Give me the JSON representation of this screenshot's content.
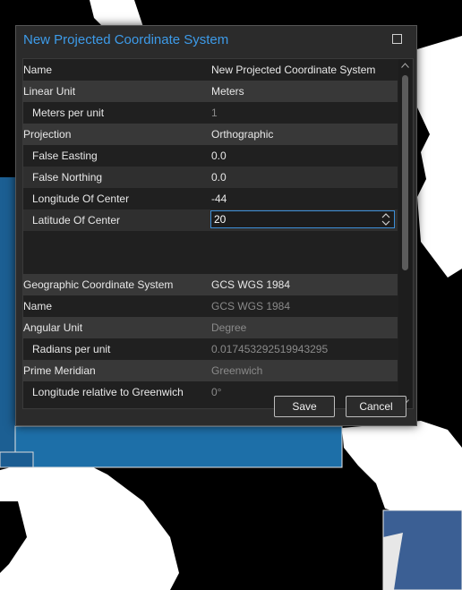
{
  "dialog": {
    "title": "New Projected Coordinate System",
    "maximize_icon": "maximize-icon",
    "rows": [
      {
        "name": "Name",
        "value": "New Projected Coordinate System"
      },
      {
        "name": "Linear Unit",
        "value": "Meters"
      },
      {
        "name": "Meters per unit",
        "value": "1"
      },
      {
        "name": "Projection",
        "value": "Orthographic"
      },
      {
        "name": "False Easting",
        "value": "0.0"
      },
      {
        "name": "False Northing",
        "value": "0.0"
      },
      {
        "name": "Longitude Of Center",
        "value": "-44"
      },
      {
        "name": "Latitude Of Center",
        "value": "20"
      },
      {
        "name": "",
        "value": ""
      },
      {
        "name": "Geographic Coordinate System",
        "value": "GCS WGS 1984"
      },
      {
        "name": "Name",
        "value": "GCS WGS 1984"
      },
      {
        "name": "Angular Unit",
        "value": "Degree"
      },
      {
        "name": "Radians per unit",
        "value": "0.017453292519943295"
      },
      {
        "name": "Prime Meridian",
        "value": "Greenwich"
      },
      {
        "name": "Longitude relative to Greenwich",
        "value": "0°"
      }
    ],
    "save_label": "Save",
    "cancel_label": "Cancel"
  },
  "colors": {
    "accent": "#3d9be9",
    "dialog_bg": "#2b2b2b",
    "ocean": "#1a6ea8",
    "land": "#ffffff"
  }
}
